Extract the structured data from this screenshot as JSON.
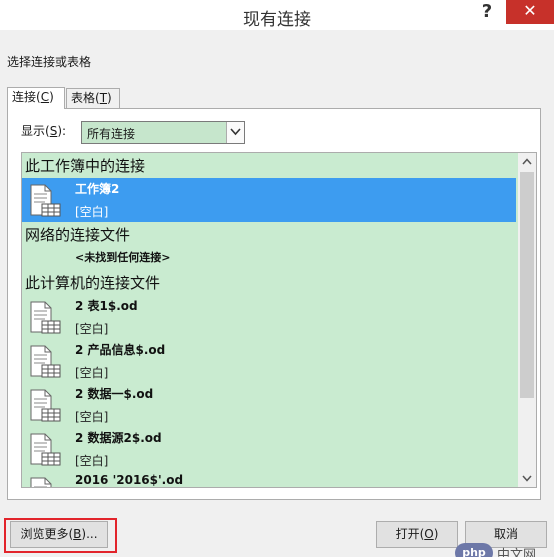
{
  "window": {
    "title": "现有连接",
    "help": "?",
    "close": "✕"
  },
  "dialog": {
    "prompt_label": "选择连接或表格"
  },
  "tabs": [
    {
      "label_pre": "连接(",
      "label_key": "C",
      "label_post": ")",
      "selected": true
    },
    {
      "label_pre": "表格(",
      "label_key": "T",
      "label_post": ")",
      "selected": false
    }
  ],
  "filter": {
    "label_pre": "显示(",
    "label_key": "S",
    "label_post": "):",
    "value": "所有连接"
  },
  "sections": [
    {
      "title": "此工作簿中的连接"
    },
    {
      "title": "网络的连接文件",
      "empty_text": "<未找到任何连接>"
    },
    {
      "title": "此计算机的连接文件"
    }
  ],
  "items": [
    {
      "name": "工作簿2",
      "desc": "[空白]",
      "selected": true
    },
    {
      "name": "2 表1$.od",
      "desc": "[空白]"
    },
    {
      "name": "2 产品信息$.od",
      "desc": "[空白]"
    },
    {
      "name": "2 数据一$.od",
      "desc": "[空白]"
    },
    {
      "name": "2 数据源2$.od",
      "desc": "[空白]"
    },
    {
      "name": "2016 '2016$'.od",
      "desc": ""
    }
  ],
  "buttons": {
    "browse_pre": "浏览更多(",
    "browse_key": "B",
    "browse_post": ")...",
    "open_pre": "打开(",
    "open_key": "O",
    "open_post": ")",
    "cancel": "取消"
  },
  "watermark": {
    "logo": "php",
    "text": "中文网"
  },
  "colors": {
    "list_bg": "#c9ebd0",
    "selected": "#3d9cf0",
    "close": "#c7312a",
    "highlight": "#e2242b"
  }
}
